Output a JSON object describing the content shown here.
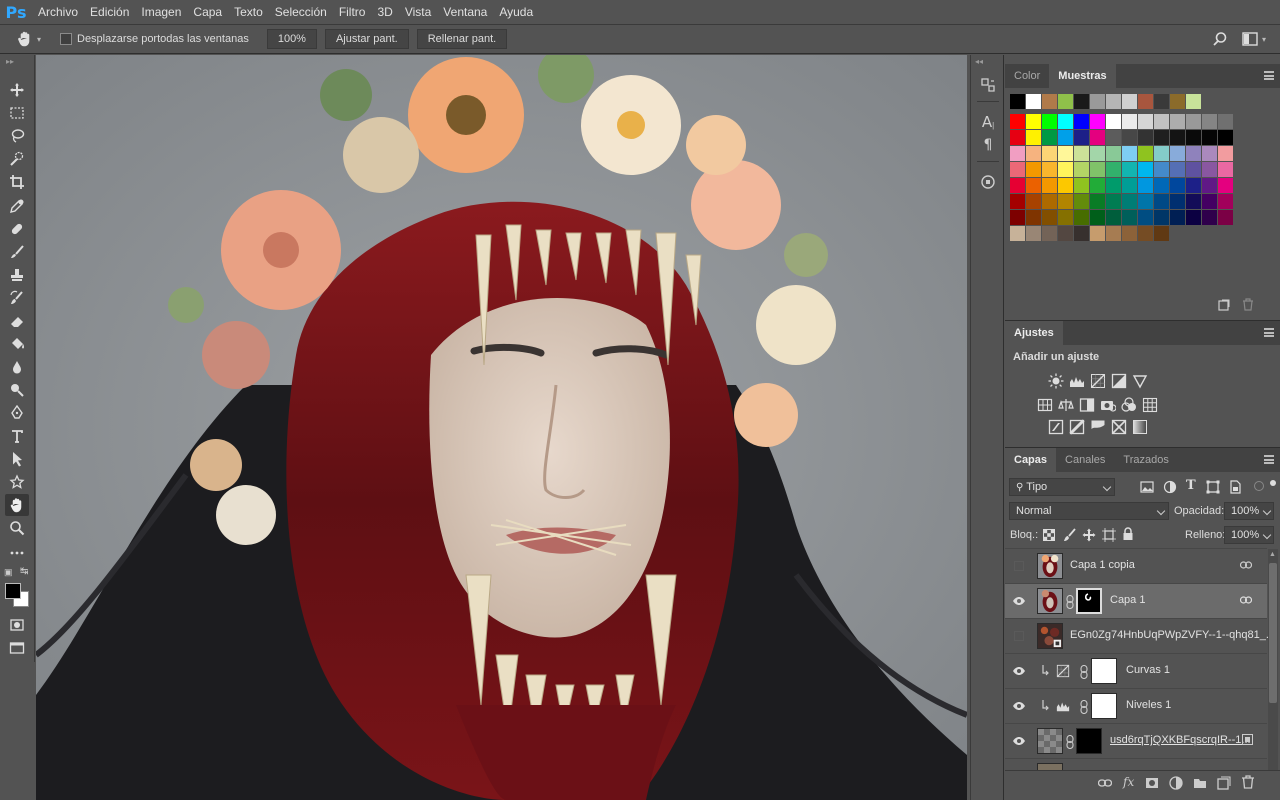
{
  "app": {
    "logo": "Ps"
  },
  "menu": [
    "Archivo",
    "Edición",
    "Imagen",
    "Capa",
    "Texto",
    "Selección",
    "Filtro",
    "3D",
    "Vista",
    "Ventana",
    "Ayuda"
  ],
  "options": {
    "tool_icon": "hand-icon",
    "scroll_all_label": "Desplazarse portodas las ventanas",
    "zoom_value": "100%",
    "fit_label": "Ajustar pant.",
    "fill_label": "Rellenar pant."
  },
  "color_panel": {
    "tabs": [
      "Color",
      "Muestras"
    ],
    "active_tab": "Muestras",
    "recent_swatches": [
      "#000000",
      "#ffffff",
      "#b07a4a",
      "#8fc04a",
      "#1a1a1a",
      "#9a9a9a",
      "#b5b5b5",
      "#d0d0d0",
      "#a8563e",
      "#3a3a3a",
      "#8b6b2a",
      "#c8e39a"
    ],
    "swatch_rows": [
      [
        "#ff0000",
        "#ffff00",
        "#00ff00",
        "#00ffff",
        "#0000ff",
        "#ff00ff",
        "#ffffff",
        "#ebebeb",
        "#d6d6d6",
        "#c2c2c2",
        "#adadad",
        "#999999",
        "#858585",
        "#707070"
      ],
      [
        "#e60012",
        "#fff100",
        "#009944",
        "#00a0e9",
        "#1d2088",
        "#e4007f",
        "#5c5c5c",
        "#474747",
        "#333333",
        "#1f1f1f",
        "#141414",
        "#0a0a0a",
        "#050505",
        "#000000"
      ],
      [
        "#f19ec2",
        "#f6b37f",
        "#fcd575",
        "#fff799",
        "#cce198",
        "#a3d6a9",
        "#89c997",
        "#7ecef4",
        "#8fc31f",
        "#84ccc9",
        "#88abda",
        "#8f82bc",
        "#aa89bd",
        "#f29c9f"
      ],
      [
        "#eb6877",
        "#f39800",
        "#f8b62d",
        "#fff45c",
        "#b3d465",
        "#80c269",
        "#32b16c",
        "#13b5b1",
        "#00b7ee",
        "#448aca",
        "#556fb5",
        "#5f52a0",
        "#8957a1",
        "#ea68a2"
      ],
      [
        "#e60033",
        "#eb6100",
        "#f39800",
        "#fcc800",
        "#8fc31f",
        "#22ac38",
        "#009b6b",
        "#009e96",
        "#0097e0",
        "#0068b7",
        "#00479d",
        "#1d2088",
        "#601986",
        "#e4007f"
      ],
      [
        "#a40000",
        "#a84200",
        "#ad6a00",
        "#b28500",
        "#638c0b",
        "#097c25",
        "#007c52",
        "#007d75",
        "#0075a9",
        "#004986",
        "#002f70",
        "#130c58",
        "#440062",
        "#a2005b"
      ],
      [
        "#7d0000",
        "#7f3400",
        "#824f00",
        "#857000",
        "#476d00",
        "#005f1a",
        "#005e3c",
        "#005f5a",
        "#004d82",
        "#003667",
        "#001f54",
        "#0c0042",
        "#2f004b",
        "#7b0045"
      ],
      [
        "#c7b299",
        "#998675",
        "#736357",
        "#534741",
        "#37302e",
        "#c69c6d",
        "#a67c52",
        "#8c6239",
        "#754c24",
        "#603913"
      ]
    ]
  },
  "adjust_panel": {
    "title": "Ajustes",
    "subtitle": "Añadir un ajuste"
  },
  "layers_panel": {
    "tabs": [
      "Capas",
      "Canales",
      "Trazados"
    ],
    "filter_label": "Tipo",
    "blend_mode": "Normal",
    "opacity_label": "Opacidad:",
    "opacity_value": "100%",
    "lock_label": "Bloq.:",
    "fill_label": "Relleno:",
    "fill_value": "100%",
    "layers": [
      {
        "name": "Capa 1 copia",
        "visible": false,
        "selected": false
      },
      {
        "name": "Capa 1",
        "visible": true,
        "selected": true
      },
      {
        "name": "EGn0Zg74HnbUqPWpZVFY--1--qhq81_...",
        "visible": false,
        "selected": false
      },
      {
        "name": "Curvas 1",
        "visible": true,
        "selected": false
      },
      {
        "name": "Niveles 1",
        "visible": true,
        "selected": false
      },
      {
        "name": "usd6rqTjQXKBFqscrqIR--1...",
        "visible": true,
        "selected": false
      }
    ]
  }
}
